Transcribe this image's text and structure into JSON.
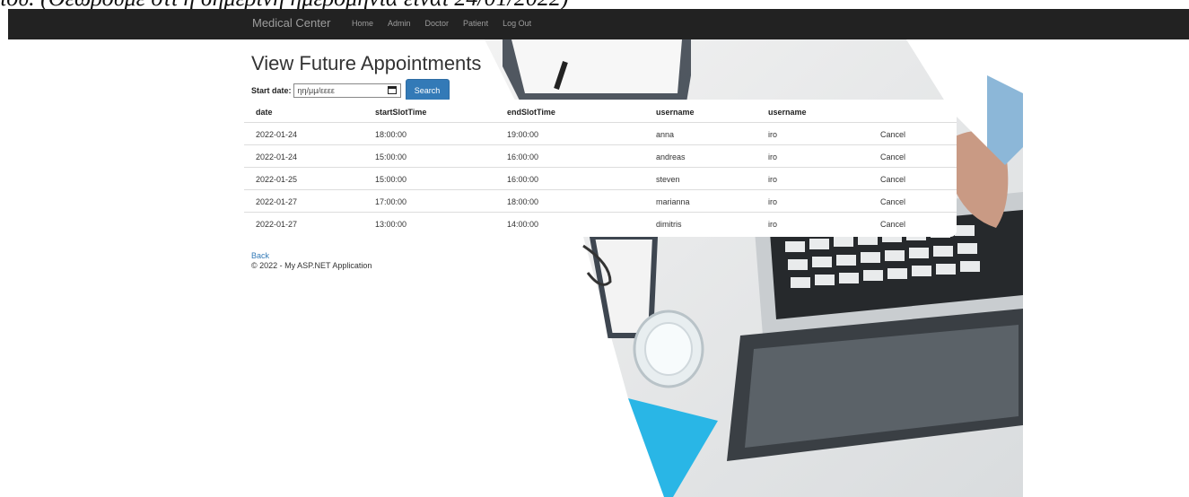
{
  "caption": "ιου. (Θεωρουμε οτι η σημερινη ημερομηνια ειναι 24/01/2022)",
  "navbar": {
    "brand": "Medical Center",
    "links": [
      "Home",
      "Admin",
      "Doctor",
      "Patient",
      "Log Out"
    ]
  },
  "page": {
    "title": "View Future Appointments",
    "start_label": "Start date:",
    "date_placeholder": "ηη/μμ/εεεε",
    "search_label": "Search"
  },
  "table": {
    "headers": [
      "date",
      "startSlotTime",
      "endSlotTime",
      "username",
      "username"
    ],
    "rows": [
      {
        "date": "2022-01-24",
        "start": "18:00:00",
        "end": "19:00:00",
        "patient": "anna",
        "doctor": "iro",
        "action": "Cancel"
      },
      {
        "date": "2022-01-24",
        "start": "15:00:00",
        "end": "16:00:00",
        "patient": "andreas",
        "doctor": "iro",
        "action": "Cancel"
      },
      {
        "date": "2022-01-25",
        "start": "15:00:00",
        "end": "16:00:00",
        "patient": "steven",
        "doctor": "iro",
        "action": "Cancel"
      },
      {
        "date": "2022-01-27",
        "start": "17:00:00",
        "end": "18:00:00",
        "patient": "marianna",
        "doctor": "iro",
        "action": "Cancel"
      },
      {
        "date": "2022-01-27",
        "start": "13:00:00",
        "end": "14:00:00",
        "patient": "dimitris",
        "doctor": "iro",
        "action": "Cancel"
      }
    ]
  },
  "footer": {
    "back": "Back",
    "copyright": "© 2022 - My ASP.NET Application"
  },
  "colors": {
    "navbar": "#222222",
    "link": "#337ab7",
    "button": "#337ab7",
    "accent_cyan": "#29b6e6"
  }
}
